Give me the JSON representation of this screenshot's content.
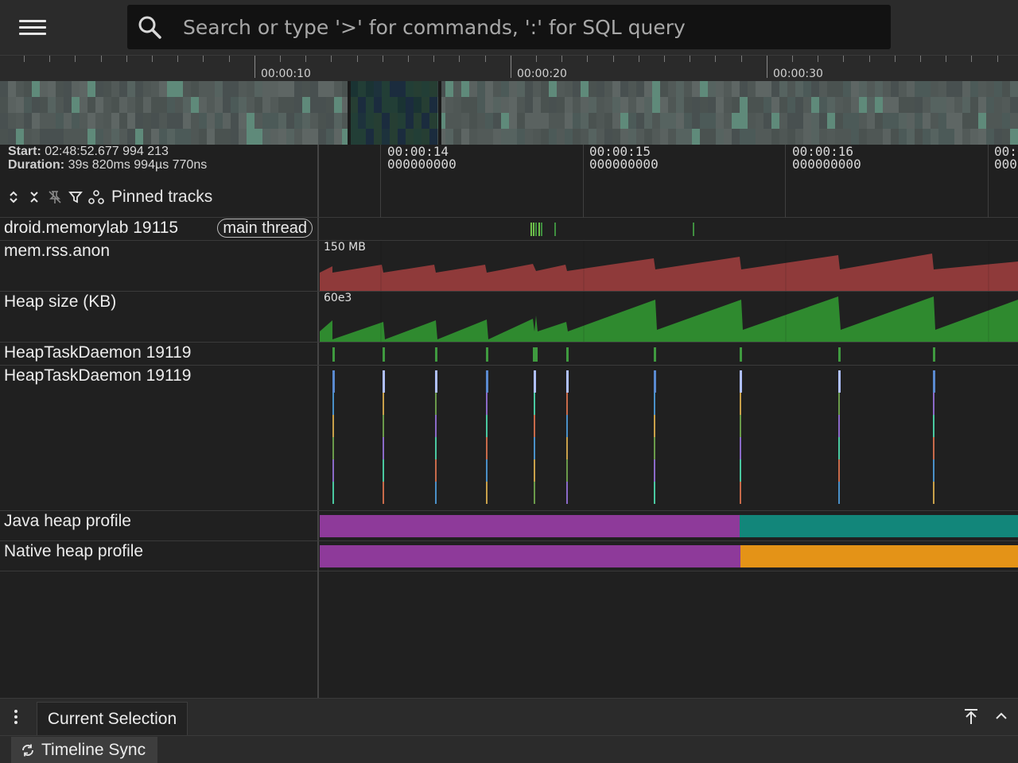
{
  "topbar": {
    "search_placeholder": "Search or type '>' for commands, ':' for SQL query"
  },
  "overview": {
    "tick_labels": [
      "00:00:10",
      "00:00:20",
      "00:00:30"
    ]
  },
  "trace_info": {
    "start_label": "Start:",
    "start_value": "02:48:52.677 994 213",
    "duration_label": "Duration:",
    "duration_value": "39s 820ms 994µs 770ns"
  },
  "pinned": {
    "label": "Pinned tracks"
  },
  "timeline": {
    "timestamps": [
      {
        "time": "00:00:14",
        "sub": "000000000"
      },
      {
        "time": "00:00:15",
        "sub": "000000000"
      },
      {
        "time": "00:00:16",
        "sub": "000000000"
      },
      {
        "time": "00:0",
        "sub": "000"
      }
    ]
  },
  "tracks": {
    "process": {
      "name": "droid.memorylab 19115",
      "chip": "main thread"
    },
    "rss": {
      "name": "mem.rss.anon",
      "scale": "150 MB"
    },
    "heap": {
      "name": "Heap size (KB)",
      "scale": "60e3"
    },
    "daemon1": {
      "name": "HeapTaskDaemon 19119"
    },
    "daemon2": {
      "name": "HeapTaskDaemon 19119"
    },
    "java": {
      "name": "Java heap profile"
    },
    "native": {
      "name": "Native heap profile"
    }
  },
  "bottom": {
    "tab_current": "Current Selection",
    "sync_label": "Timeline Sync"
  },
  "colors": {
    "rss": "#8f3a3a",
    "heap": "#2f8a2f",
    "profile_left": "#8e3a9a",
    "java_right": "#12867a",
    "native_right": "#e49317"
  }
}
